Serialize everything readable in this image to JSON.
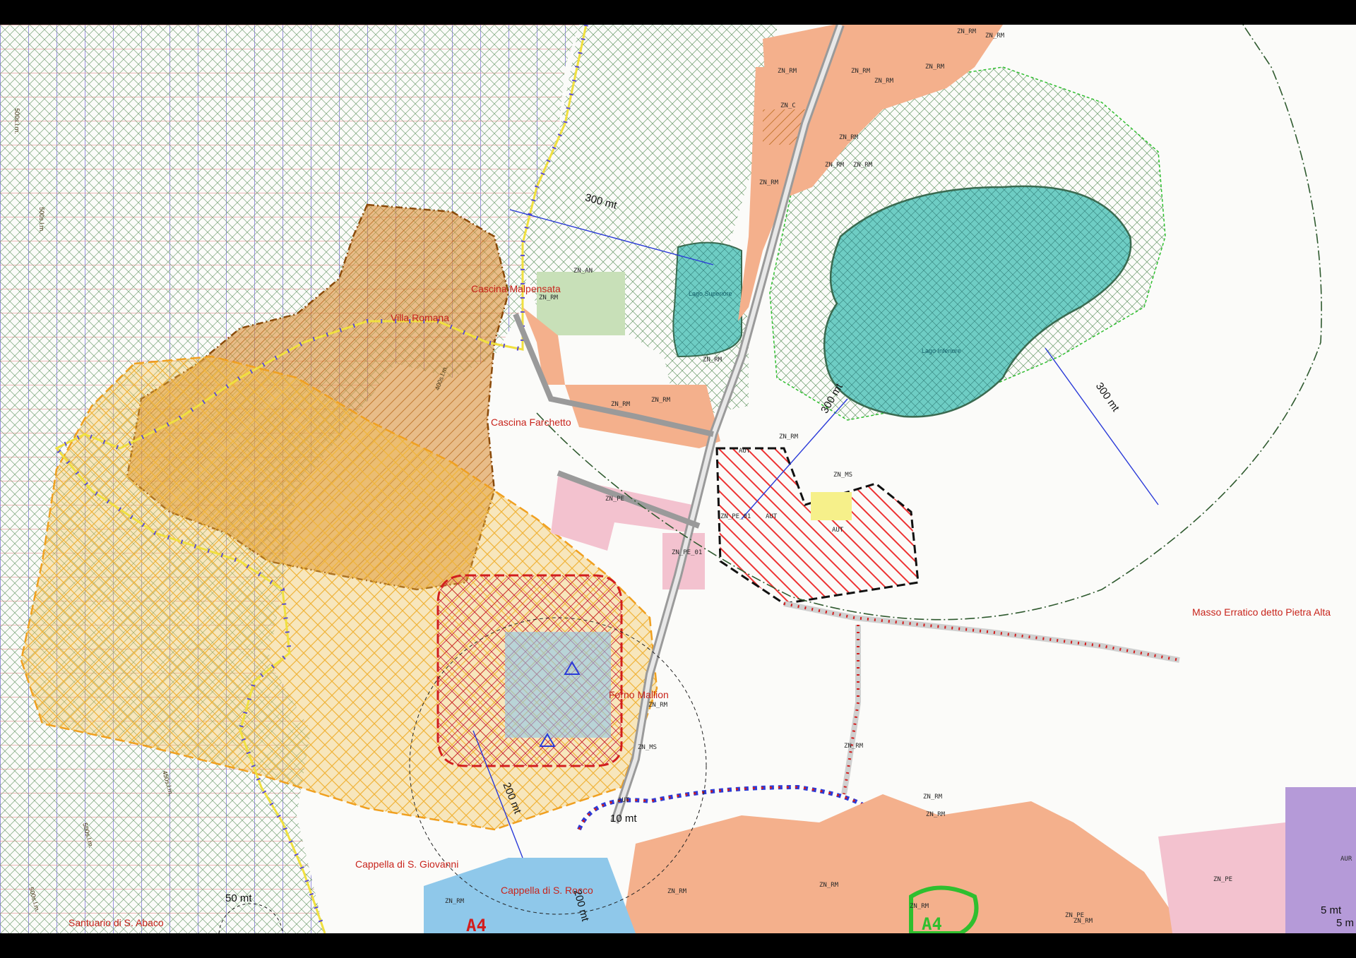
{
  "places": {
    "cascina_malpensata": "Cascina Malpensata",
    "villa_romana": "Villa Romana",
    "cascina_farchetto": "Cascina Farchetto",
    "forno_mallion": "Forno Mallion",
    "masso_erratico": "Masso Erratico detto Pietra Alta",
    "cappella_giovanni": "Cappella di S. Giovanni",
    "cappella_rocco": "Cappella di S. Rocco",
    "santuario_abaco": "Santuario di S. Abaco"
  },
  "distances": {
    "d300_left": "300 mt",
    "d300_mid": "300 mt",
    "d300_right": "300 mt",
    "d200_a": "200 mt",
    "d200_b": "200 mt",
    "d10": "10 mt",
    "d50": "50 mt",
    "d5_a": "5 mt",
    "d5_b": "5 m"
  },
  "lakes": {
    "upper": "Lago Superiore",
    "lower": "Lago Inferiore"
  },
  "contours": {
    "c1": "500s.l.m.",
    "c2": "500s.l.m.",
    "c3": "400s.l.m.",
    "c4": "450s.l.m.",
    "c5": "500s.l.m.",
    "c6": "500s.l.m."
  },
  "zones": {
    "rm1": "ZN_RM",
    "rm2": "ZN_RM",
    "rm3": "ZN_RM",
    "rm4": "ZN_RM",
    "rm5": "ZN_RM",
    "rm6": "ZN_RM",
    "rm7": "ZN_RM",
    "rm8": "ZN_RM",
    "rm9": "ZN_RM",
    "rm10": "ZN_RM",
    "rm11": "ZN_RM",
    "rm12": "ZN_RM",
    "rm13": "ZN_RM",
    "rm14": "ZN_RM",
    "rm15": "ZN_RM",
    "rm16": "ZN_RM",
    "rm17": "ZN_RM",
    "rm18": "ZN_RM",
    "rm19": "ZN_RM",
    "rm20": "ZN_RM",
    "rm21": "ZN_RM",
    "rm22": "ZN_RM",
    "rm23": "ZN_RM",
    "rm24": "ZN_RM",
    "zc": "ZN_C",
    "an": "ZN_AN",
    "pe1": "ZN_PE",
    "pe2": "ZN_PE",
    "pe01a": "ZN_PE_01",
    "pe01b": "ZN_PE_01",
    "ms1": "ZN_MS",
    "ms2": "ZN_MS",
    "aut1": "AUT",
    "aut2": "AUT",
    "aut3": "AUT",
    "aut4": "AUT",
    "pe3": "ZN_PE",
    "aur": "AUR",
    "a4_1": "A4",
    "a4_2": "A4"
  },
  "colors": {
    "residential": "#f4b08c",
    "lake": "#6ecdc4",
    "orange_zone": "#d9882c",
    "yellow_zone": "#f0c04a",
    "pink_zone": "#f3c2cf",
    "red_dash": "#d21e1e",
    "green_zone": "#2f7a2f",
    "blue_grid": "#5d4fd0",
    "red_grid": "#e07a7a"
  }
}
